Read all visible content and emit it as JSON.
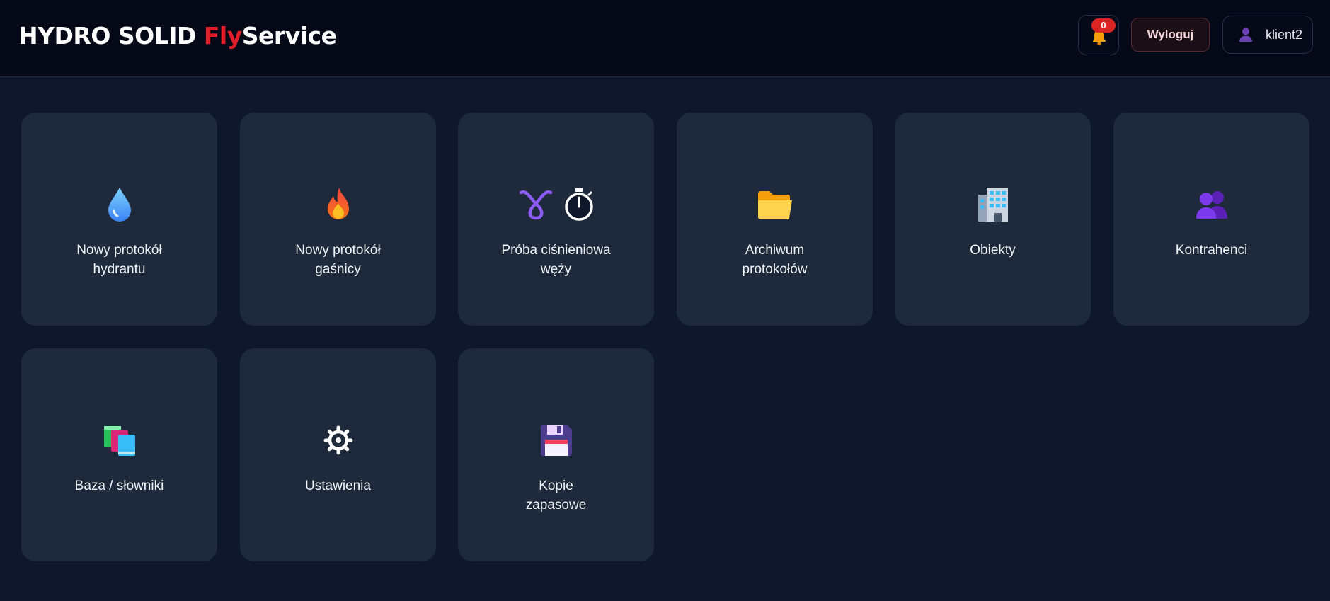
{
  "header": {
    "brand_main": "HYDRO SOLID",
    "brand_fly": "Fly",
    "brand_service": "Service",
    "notification_count": "0",
    "logout_label": "Wyloguj",
    "username": "klient2"
  },
  "tiles": [
    {
      "line1": "Nowy protokół",
      "line2": "hydrantu",
      "icon": "droplet-icon"
    },
    {
      "line1": "Nowy protokół",
      "line2": "gaśnicy",
      "icon": "fire-icon"
    },
    {
      "line1": "Próba ciśnieniowa",
      "line2": "węży",
      "icon": "hose-loop-icon, stopwatch-icon"
    },
    {
      "line1": "Archiwum",
      "line2": "protokołów",
      "icon": "folder-icon"
    },
    {
      "line1": "Obiekty",
      "line2": "",
      "icon": "building-icon"
    },
    {
      "line1": "Kontrahenci",
      "line2": "",
      "icon": "users-icon"
    },
    {
      "line1": "Baza / słowniki",
      "line2": "",
      "icon": "books-icon"
    },
    {
      "line1": "Ustawienia",
      "line2": "",
      "icon": "gear-icon"
    },
    {
      "line1": "Kopie",
      "line2": "zapasowe",
      "icon": "floppy-disk-icon"
    }
  ],
  "colors": {
    "background": "#0f172a",
    "topbar": "#050816",
    "tile": "#1e293b",
    "brand_accent": "#e11d2a",
    "badge": "#dc2626"
  }
}
